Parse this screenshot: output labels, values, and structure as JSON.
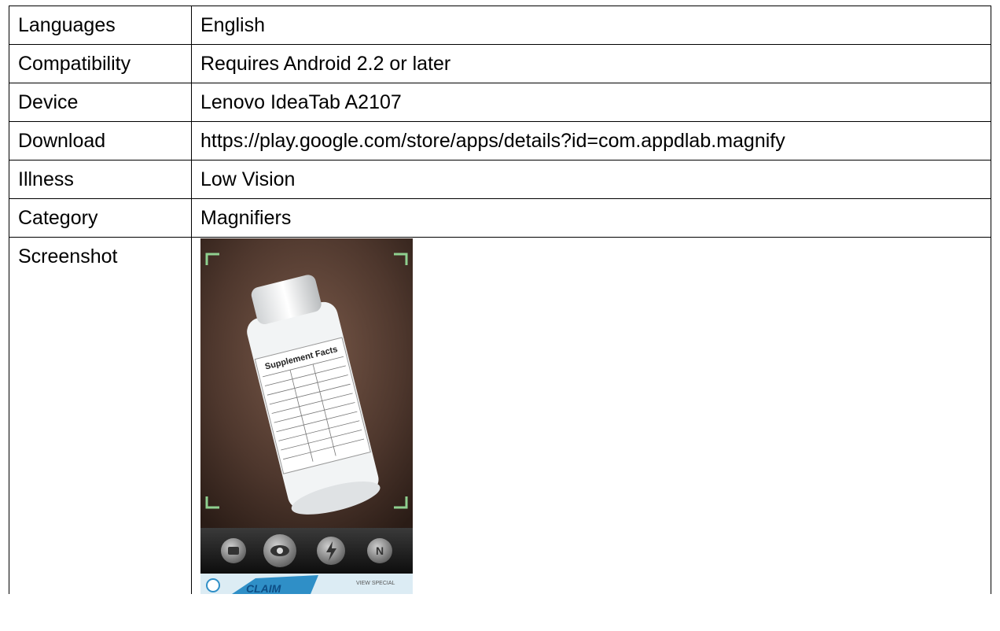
{
  "rows": [
    {
      "label": "Languages",
      "value": "English"
    },
    {
      "label": "Compatibility",
      "value": "Requires Android 2.2 or later"
    },
    {
      "label": "Device",
      "value": "Lenovo IdeaTab A2107"
    },
    {
      "label": "Download",
      "value": "https://play.google.com/store/apps/details?id=com.appdlab.magnify"
    },
    {
      "label": "Illness",
      "value": "Low Vision"
    },
    {
      "label": "Category",
      "value": "Magnifiers"
    }
  ],
  "screenshot": {
    "label": "Screenshot",
    "bottle_label_text": "Supplement Facts",
    "toolbar_buttons": [
      "camera-icon",
      "eye-icon",
      "flash-icon",
      "N"
    ],
    "ad_text": "VIEW SPECIAL",
    "ad_brand": "CLAIM"
  }
}
